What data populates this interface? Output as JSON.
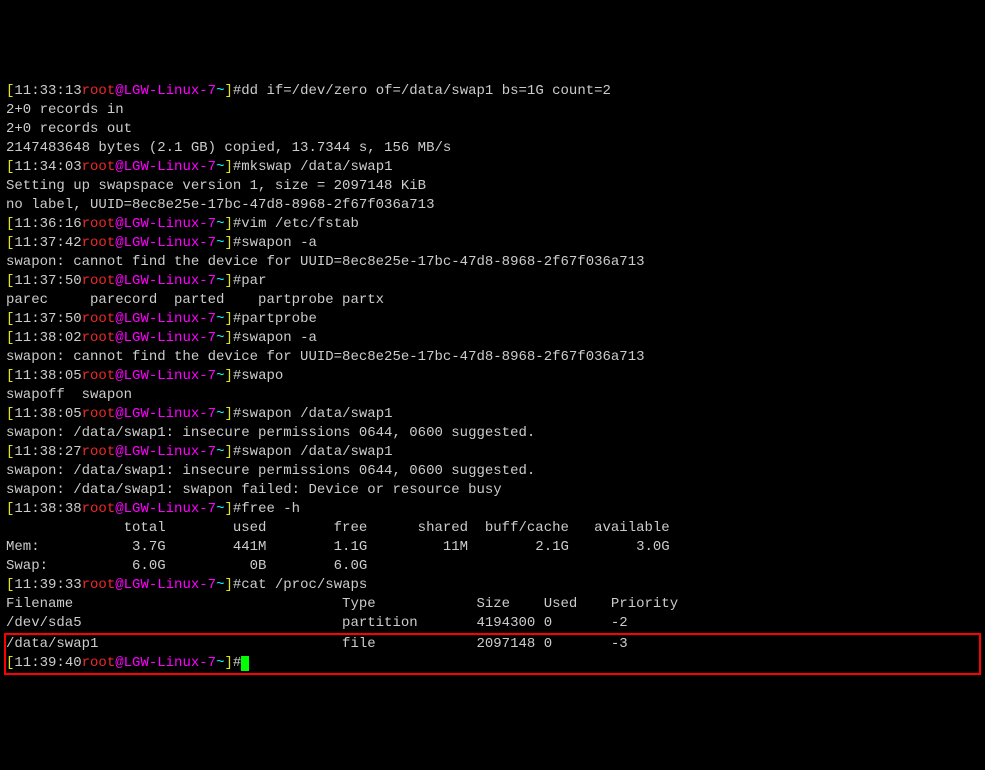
{
  "lines": [
    {
      "segments": [
        {
          "cls": "yellow",
          "path": "p0.s0",
          "text": "["
        },
        {
          "cls": "white",
          "path": "p0.s1",
          "text": "11:33:13"
        },
        {
          "cls": "red",
          "path": "p0.s2",
          "text": "root"
        },
        {
          "cls": "magenta",
          "path": "p0.s3",
          "text": "@LGW-Linux-7"
        },
        {
          "cls": "cyan",
          "path": "p0.s4",
          "text": "~"
        },
        {
          "cls": "yellow",
          "path": "p0.s5",
          "text": "]"
        },
        {
          "cls": "white",
          "path": "p0.s6",
          "text": "#dd if=/dev/zero of=/data/swap1 bs=1G count=2"
        }
      ]
    },
    {
      "segments": [
        {
          "cls": "white",
          "path": "p1.s0",
          "text": "2+0 records in"
        }
      ]
    },
    {
      "segments": [
        {
          "cls": "white",
          "path": "p2.s0",
          "text": "2+0 records out"
        }
      ]
    },
    {
      "segments": [
        {
          "cls": "white",
          "path": "p3.s0",
          "text": "2147483648 bytes (2.1 GB) copied, 13.7344 s, 156 MB/s"
        }
      ]
    },
    {
      "segments": [
        {
          "cls": "yellow",
          "path": "p4.s0",
          "text": "["
        },
        {
          "cls": "white",
          "path": "p4.s1",
          "text": "11:34:03"
        },
        {
          "cls": "red",
          "path": "p4.s2",
          "text": "root"
        },
        {
          "cls": "magenta",
          "path": "p4.s3",
          "text": "@LGW-Linux-7"
        },
        {
          "cls": "cyan",
          "path": "p4.s4",
          "text": "~"
        },
        {
          "cls": "yellow",
          "path": "p4.s5",
          "text": "]"
        },
        {
          "cls": "white",
          "path": "p4.s6",
          "text": "#mkswap /data/swap1"
        }
      ]
    },
    {
      "segments": [
        {
          "cls": "white",
          "path": "p5.s0",
          "text": "Setting up swapspace version 1, size = 2097148 KiB"
        }
      ]
    },
    {
      "segments": [
        {
          "cls": "white",
          "path": "p6.s0",
          "text": "no label, UUID=8ec8e25e-17bc-47d8-8968-2f67f036a713"
        }
      ]
    },
    {
      "segments": [
        {
          "cls": "yellow",
          "path": "p7.s0",
          "text": "["
        },
        {
          "cls": "white",
          "path": "p7.s1",
          "text": "11:36:16"
        },
        {
          "cls": "red",
          "path": "p7.s2",
          "text": "root"
        },
        {
          "cls": "magenta",
          "path": "p7.s3",
          "text": "@LGW-Linux-7"
        },
        {
          "cls": "cyan",
          "path": "p7.s4",
          "text": "~"
        },
        {
          "cls": "yellow",
          "path": "p7.s5",
          "text": "]"
        },
        {
          "cls": "white",
          "path": "p7.s6",
          "text": "#vim /etc/fstab"
        }
      ]
    },
    {
      "segments": [
        {
          "cls": "yellow",
          "path": "p8.s0",
          "text": "["
        },
        {
          "cls": "white",
          "path": "p8.s1",
          "text": "11:37:42"
        },
        {
          "cls": "red",
          "path": "p8.s2",
          "text": "root"
        },
        {
          "cls": "magenta",
          "path": "p8.s3",
          "text": "@LGW-Linux-7"
        },
        {
          "cls": "cyan",
          "path": "p8.s4",
          "text": "~"
        },
        {
          "cls": "yellow",
          "path": "p8.s5",
          "text": "]"
        },
        {
          "cls": "white",
          "path": "p8.s6",
          "text": "#swapon -a"
        }
      ]
    },
    {
      "segments": [
        {
          "cls": "white",
          "path": "p9.s0",
          "text": "swapon: cannot find the device for UUID=8ec8e25e-17bc-47d8-8968-2f67f036a713"
        }
      ]
    },
    {
      "segments": [
        {
          "cls": "yellow",
          "path": "p10.s0",
          "text": "["
        },
        {
          "cls": "white",
          "path": "p10.s1",
          "text": "11:37:50"
        },
        {
          "cls": "red",
          "path": "p10.s2",
          "text": "root"
        },
        {
          "cls": "magenta",
          "path": "p10.s3",
          "text": "@LGW-Linux-7"
        },
        {
          "cls": "cyan",
          "path": "p10.s4",
          "text": "~"
        },
        {
          "cls": "yellow",
          "path": "p10.s5",
          "text": "]"
        },
        {
          "cls": "white",
          "path": "p10.s6",
          "text": "#par"
        }
      ]
    },
    {
      "segments": [
        {
          "cls": "white",
          "path": "p11.s0",
          "text": "parec     parecord  parted    partprobe partx"
        }
      ]
    },
    {
      "segments": [
        {
          "cls": "yellow",
          "path": "p12.s0",
          "text": "["
        },
        {
          "cls": "white",
          "path": "p12.s1",
          "text": "11:37:50"
        },
        {
          "cls": "red",
          "path": "p12.s2",
          "text": "root"
        },
        {
          "cls": "magenta",
          "path": "p12.s3",
          "text": "@LGW-Linux-7"
        },
        {
          "cls": "cyan",
          "path": "p12.s4",
          "text": "~"
        },
        {
          "cls": "yellow",
          "path": "p12.s5",
          "text": "]"
        },
        {
          "cls": "white",
          "path": "p12.s6",
          "text": "#partprobe"
        }
      ]
    },
    {
      "segments": [
        {
          "cls": "yellow",
          "path": "p13.s0",
          "text": "["
        },
        {
          "cls": "white",
          "path": "p13.s1",
          "text": "11:38:02"
        },
        {
          "cls": "red",
          "path": "p13.s2",
          "text": "root"
        },
        {
          "cls": "magenta",
          "path": "p13.s3",
          "text": "@LGW-Linux-7"
        },
        {
          "cls": "cyan",
          "path": "p13.s4",
          "text": "~"
        },
        {
          "cls": "yellow",
          "path": "p13.s5",
          "text": "]"
        },
        {
          "cls": "white",
          "path": "p13.s6",
          "text": "#swapon -a"
        }
      ]
    },
    {
      "segments": [
        {
          "cls": "white",
          "path": "p14.s0",
          "text": "swapon: cannot find the device for UUID=8ec8e25e-17bc-47d8-8968-2f67f036a713"
        }
      ]
    },
    {
      "segments": [
        {
          "cls": "yellow",
          "path": "p15.s0",
          "text": "["
        },
        {
          "cls": "white",
          "path": "p15.s1",
          "text": "11:38:05"
        },
        {
          "cls": "red",
          "path": "p15.s2",
          "text": "root"
        },
        {
          "cls": "magenta",
          "path": "p15.s3",
          "text": "@LGW-Linux-7"
        },
        {
          "cls": "cyan",
          "path": "p15.s4",
          "text": "~"
        },
        {
          "cls": "yellow",
          "path": "p15.s5",
          "text": "]"
        },
        {
          "cls": "white",
          "path": "p15.s6",
          "text": "#swapo"
        }
      ]
    },
    {
      "segments": [
        {
          "cls": "white",
          "path": "p16.s0",
          "text": "swapoff  swapon"
        }
      ]
    },
    {
      "segments": [
        {
          "cls": "yellow",
          "path": "p17.s0",
          "text": "["
        },
        {
          "cls": "white",
          "path": "p17.s1",
          "text": "11:38:05"
        },
        {
          "cls": "red",
          "path": "p17.s2",
          "text": "root"
        },
        {
          "cls": "magenta",
          "path": "p17.s3",
          "text": "@LGW-Linux-7"
        },
        {
          "cls": "cyan",
          "path": "p17.s4",
          "text": "~"
        },
        {
          "cls": "yellow",
          "path": "p17.s5",
          "text": "]"
        },
        {
          "cls": "white",
          "path": "p17.s6",
          "text": "#swapon /data/swap1"
        }
      ]
    },
    {
      "segments": [
        {
          "cls": "white",
          "path": "p18.s0",
          "text": "swapon: /data/swap1: insecure permissions 0644, 0600 suggested."
        }
      ]
    },
    {
      "segments": [
        {
          "cls": "yellow",
          "path": "p19.s0",
          "text": "["
        },
        {
          "cls": "white",
          "path": "p19.s1",
          "text": "11:38:27"
        },
        {
          "cls": "red",
          "path": "p19.s2",
          "text": "root"
        },
        {
          "cls": "magenta",
          "path": "p19.s3",
          "text": "@LGW-Linux-7"
        },
        {
          "cls": "cyan",
          "path": "p19.s4",
          "text": "~"
        },
        {
          "cls": "yellow",
          "path": "p19.s5",
          "text": "]"
        },
        {
          "cls": "white",
          "path": "p19.s6",
          "text": "#swapon /data/swap1"
        }
      ]
    },
    {
      "segments": [
        {
          "cls": "white",
          "path": "p20.s0",
          "text": "swapon: /data/swap1: insecure permissions 0644, 0600 suggested."
        }
      ]
    },
    {
      "segments": [
        {
          "cls": "white",
          "path": "p21.s0",
          "text": "swapon: /data/swap1: swapon failed: Device or resource busy"
        }
      ]
    },
    {
      "segments": [
        {
          "cls": "yellow",
          "path": "p22.s0",
          "text": "["
        },
        {
          "cls": "white",
          "path": "p22.s1",
          "text": "11:38:38"
        },
        {
          "cls": "red",
          "path": "p22.s2",
          "text": "root"
        },
        {
          "cls": "magenta",
          "path": "p22.s3",
          "text": "@LGW-Linux-7"
        },
        {
          "cls": "cyan",
          "path": "p22.s4",
          "text": "~"
        },
        {
          "cls": "yellow",
          "path": "p22.s5",
          "text": "]"
        },
        {
          "cls": "white",
          "path": "p22.s6",
          "text": "#free -h"
        }
      ]
    },
    {
      "segments": [
        {
          "cls": "white",
          "path": "p23.s0",
          "text": "              total        used        free      shared  buff/cache   available"
        }
      ]
    },
    {
      "segments": [
        {
          "cls": "white",
          "path": "p24.s0",
          "text": "Mem:           3.7G        441M        1.1G         11M        2.1G        3.0G"
        }
      ]
    },
    {
      "segments": [
        {
          "cls": "white",
          "path": "p25.s0",
          "text": "Swap:          6.0G          0B        6.0G"
        }
      ]
    },
    {
      "segments": [
        {
          "cls": "yellow",
          "path": "p26.s0",
          "text": "["
        },
        {
          "cls": "white",
          "path": "p26.s1",
          "text": "11:39:33"
        },
        {
          "cls": "red",
          "path": "p26.s2",
          "text": "root"
        },
        {
          "cls": "magenta",
          "path": "p26.s3",
          "text": "@LGW-Linux-7"
        },
        {
          "cls": "cyan",
          "path": "p26.s4",
          "text": "~"
        },
        {
          "cls": "yellow",
          "path": "p26.s5",
          "text": "]"
        },
        {
          "cls": "white",
          "path": "p26.s6",
          "text": "#cat /proc/swaps"
        }
      ]
    },
    {
      "segments": [
        {
          "cls": "white",
          "path": "p27.s0",
          "text": "Filename                                Type            Size    Used    Priority"
        }
      ]
    },
    {
      "segments": [
        {
          "cls": "white",
          "path": "p28.s0",
          "text": "/dev/sda5                               partition       4194300 0       -2"
        }
      ]
    }
  ],
  "hl": {
    "line1": "/data/swap1                             file            2097148 0       -3",
    "prompt": {
      "b1": "[",
      "time": "11:39:40",
      "user": "root",
      "host": "@LGW-Linux-7",
      "dir": "~",
      "b2": "]",
      "hash": "#"
    }
  }
}
